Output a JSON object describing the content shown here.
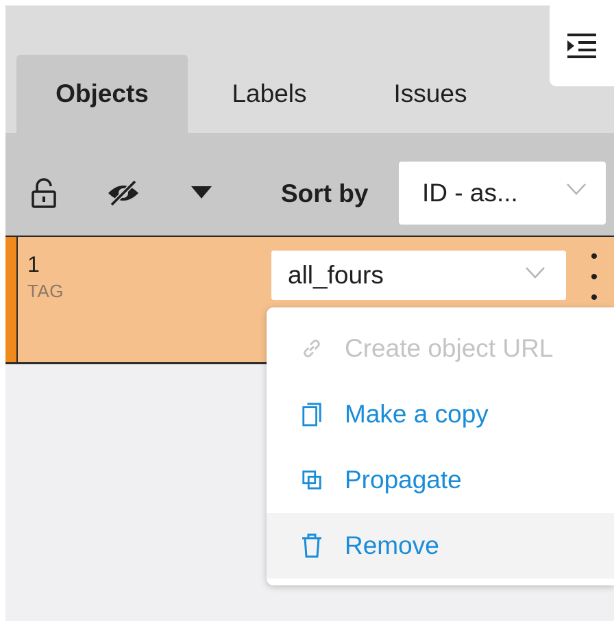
{
  "tabs": [
    {
      "label": "Objects",
      "active": true
    },
    {
      "label": "Labels",
      "active": false
    },
    {
      "label": "Issues",
      "active": false
    }
  ],
  "toolbar": {
    "sort_label": "Sort by",
    "sort_value": "ID - as..."
  },
  "object": {
    "id": "1",
    "type": "TAG",
    "label": "all_fours",
    "row_color": "#f5c08c",
    "accent_color": "#f08a1c"
  },
  "menu": {
    "items": [
      {
        "label": "Create object URL",
        "icon": "link-icon",
        "disabled": true
      },
      {
        "label": "Make a copy",
        "icon": "copy-icon",
        "disabled": false
      },
      {
        "label": "Propagate",
        "icon": "propagate-icon",
        "disabled": false
      },
      {
        "label": "Remove",
        "icon": "trash-icon",
        "disabled": false
      }
    ],
    "accent_color": "#1a8cd8"
  }
}
